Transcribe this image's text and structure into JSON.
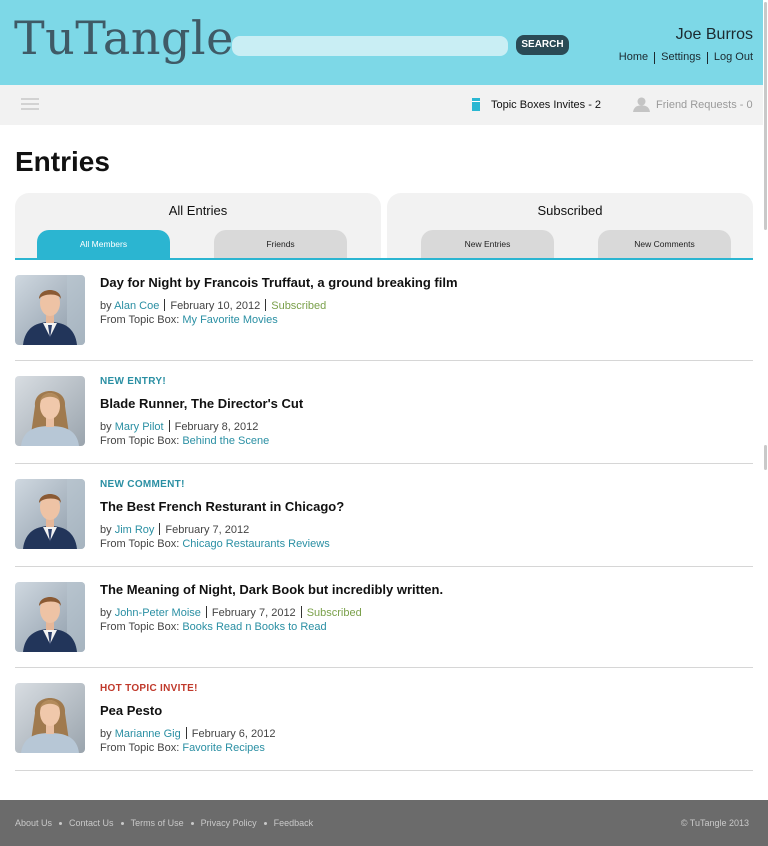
{
  "header": {
    "logo": "TuTangle",
    "search_placeholder": "",
    "search_button": "SEARCH",
    "user_name": "Joe Burros",
    "nav": [
      "Home",
      "Settings",
      "Log Out"
    ]
  },
  "subbar": {
    "topic_invites": "Topic Boxes Invites - 2",
    "friend_requests": "Friend Requests - 0"
  },
  "page": {
    "title": "Entries"
  },
  "tabs": {
    "all_entries": {
      "title": "All Entries",
      "items": [
        "All Members",
        "Friends"
      ],
      "active": "All Members"
    },
    "subscribed": {
      "title": "Subscribed",
      "items": [
        "New Entries",
        "New Comments"
      ]
    }
  },
  "entries": [
    {
      "badge": "",
      "title": "Day for Night by Francois Truffaut, a ground breaking film",
      "by": "by",
      "author": "Alan Coe",
      "date": "February 10, 2012",
      "status": "Subscribed",
      "from_label": "From Topic Box:",
      "topic_box": "My Favorite Movies"
    },
    {
      "badge": "NEW ENTRY!",
      "title": "Blade Runner, The Director's Cut",
      "by": "by",
      "author": "Mary Pilot",
      "date": "February 8, 2012",
      "status": "",
      "from_label": "From Topic Box:",
      "topic_box": "Behind the Scene"
    },
    {
      "badge": "NEW COMMENT!",
      "title": "The Best French Resturant in Chicago?",
      "by": "by",
      "author": "Jim Roy",
      "date": "February 7, 2012",
      "status": "",
      "from_label": "From Topic Box:",
      "topic_box": "Chicago Restaurants Reviews"
    },
    {
      "badge": "",
      "title": "The Meaning of Night, Dark Book but incredibly written.",
      "by": "by",
      "author": "John-Peter Moise",
      "date": "February 7, 2012",
      "status": "Subscribed",
      "from_label": "From Topic Box:",
      "topic_box": "Books Read n Books to Read"
    },
    {
      "badge": "HOT TOPIC INVITE!",
      "title": "Pea Pesto",
      "by": "by",
      "author": "Marianne Gig",
      "date": "February 6, 2012",
      "status": "",
      "from_label": "From Topic Box:",
      "topic_box": "Favorite Recipes"
    }
  ],
  "footer": {
    "links": [
      "About Us",
      "Contact Us",
      "Terms of Use",
      "Privacy Policy",
      "Feedback"
    ],
    "copyright": "© TuTangle 2013"
  },
  "colors": {
    "header_bg": "#7dd8e7",
    "accent": "#2bb5d1",
    "link": "#2a8fa3",
    "subscribed": "#7aa04a",
    "hot": "#c0392b",
    "footer_bg": "#6b6b6b"
  },
  "icons": {
    "menu": "hamburger-menu-icon",
    "topic_box": "topic-box-icon",
    "friend": "person-icon"
  }
}
